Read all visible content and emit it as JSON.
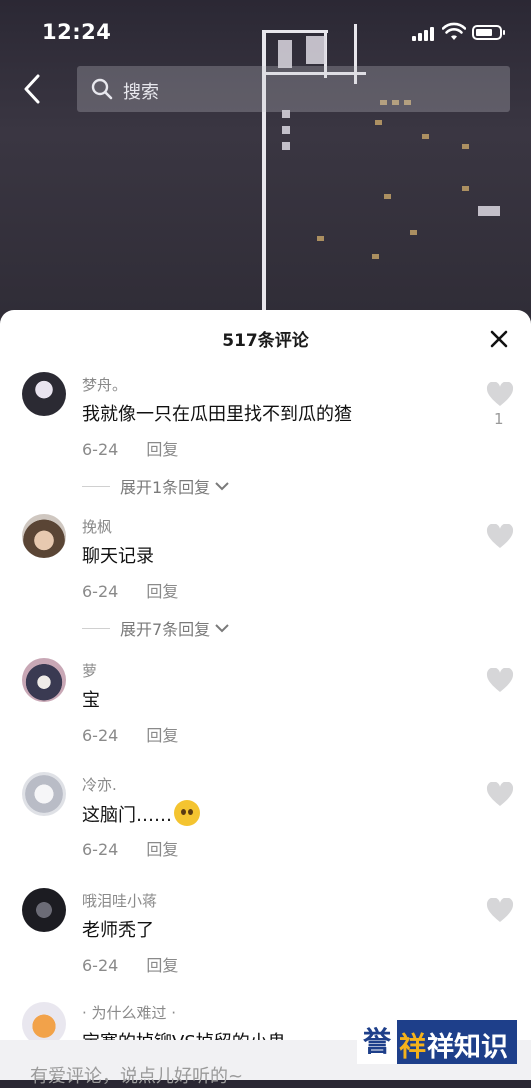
{
  "status_bar": {
    "time": "12:24"
  },
  "search": {
    "placeholder": "搜索"
  },
  "sheet": {
    "title": "517条评论"
  },
  "comments": [
    {
      "user": "梦舟。",
      "text": "我就像一只在瓜田里找不到瓜的猹",
      "date": "6-24",
      "reply": "回复",
      "likes": "1",
      "expand": "展开1条回复"
    },
    {
      "user": "挽枫",
      "text": "聊天记录",
      "date": "6-24",
      "reply": "回复",
      "expand": "展开7条回复"
    },
    {
      "user": "萝",
      "text": "宝",
      "date": "6-24",
      "reply": "回复"
    },
    {
      "user": "冷亦.",
      "text": "这脑门……",
      "date": "6-24",
      "reply": "回复"
    },
    {
      "user": "哦泪哇小蒋",
      "text": "老师秃了",
      "date": "6-24",
      "reply": "回复"
    },
    {
      "user": "· 为什么难过 ·",
      "text": "宝塞的掉铆VS掉留的小鬼"
    }
  ],
  "input": {
    "placeholder": "有爱评论，说点儿好听的~"
  },
  "watermark": {
    "box": "誉",
    "t1": "祥",
    "t2": "祥知识"
  },
  "colors": {
    "sheet_bg": "#ffffff",
    "muted": "#8a8a8a",
    "watermark_blue": "#1e3f8a",
    "watermark_gold": "#f5b21b"
  }
}
